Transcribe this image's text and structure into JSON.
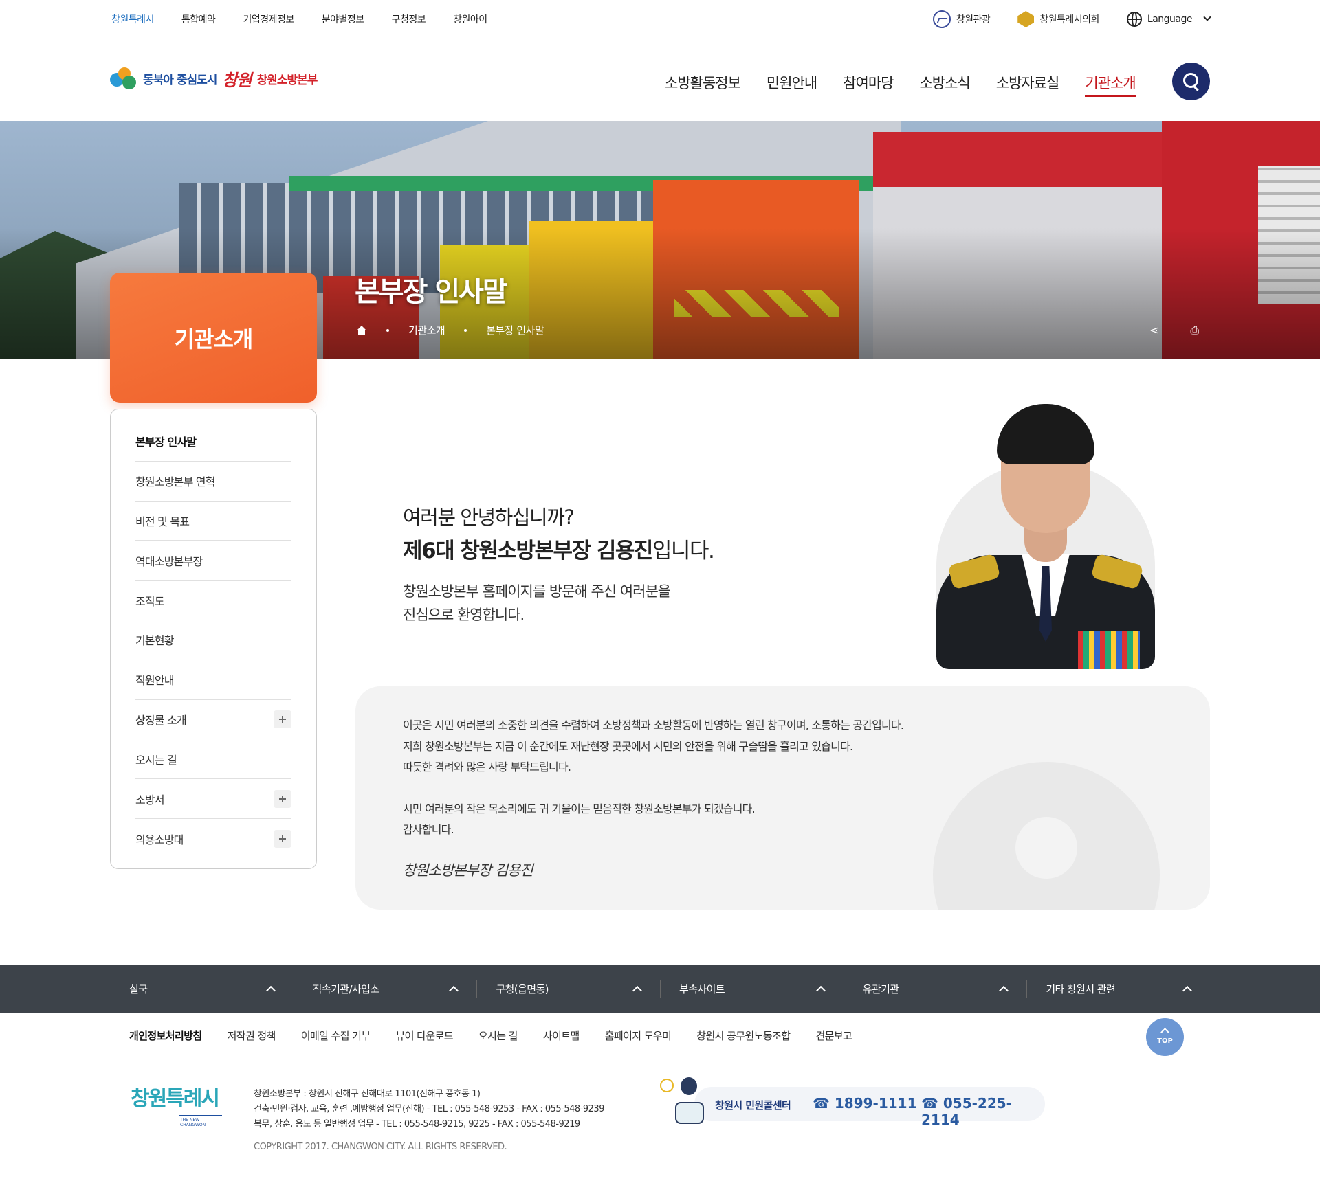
{
  "top_util": {
    "left_links": [
      "창원특례시",
      "통합예약",
      "기업경제정보",
      "분야별정보",
      "구청정보",
      "창원아이"
    ],
    "right_links": [
      "창원관광",
      "창원특례시의회",
      "Language"
    ]
  },
  "header": {
    "logo_text1": "동북아 중심도시",
    "logo_script": "창원",
    "logo_text2": "창원소방본부",
    "gnb": [
      "소방활동정보",
      "민원안내",
      "참여마당",
      "소방소식",
      "소방자료실",
      "기관소개"
    ]
  },
  "hero": {
    "title": "본부장 인사말",
    "breadcrumb": [
      "기관소개",
      "본부장 인사말"
    ],
    "share_icon": "share-icon",
    "print_icon": "print-icon"
  },
  "lnb": {
    "title": "기관소개",
    "items": [
      {
        "label": "본부장 인사말",
        "expandable": false
      },
      {
        "label": "창원소방본부 연혁",
        "expandable": false
      },
      {
        "label": "비전 및 목표",
        "expandable": false
      },
      {
        "label": "역대소방본부장",
        "expandable": false
      },
      {
        "label": "조직도",
        "expandable": false
      },
      {
        "label": "기본현황",
        "expandable": false
      },
      {
        "label": "직원안내",
        "expandable": false
      },
      {
        "label": "상징물 소개",
        "expandable": true
      },
      {
        "label": "오시는 길",
        "expandable": false
      },
      {
        "label": "소방서",
        "expandable": true
      },
      {
        "label": "의용소방대",
        "expandable": true
      }
    ]
  },
  "greeting": {
    "line1": "여러분 안녕하십니까?",
    "line2_bold": "제6대 창원소방본부장 김용진",
    "line2_rest": "입니다.",
    "line3": "창원소방본부 홈페이지를 방문해 주신 여러분을",
    "line4": "진심으로 환영합니다."
  },
  "message": {
    "paragraphs": [
      "이곳은 시민 여러분의 소중한 의견을 수렴하여 소방정책과 소방활동에 반영하는 열린 창구이며, 소통하는 공간입니다.",
      "저희 창원소방본부는 지금 이 순간에도 재난현장 곳곳에서 시민의 안전을 위해 구슬땀을 흘리고 있습니다.",
      "따듯한 격려와 많은 사랑 부탁드립니다.",
      "",
      "시민 여러분의 작은 목소리에도 귀 기울이는 믿음직한 창원소방본부가 되겠습니다.",
      "감사합니다."
    ],
    "signature": "창원소방본부장 김용진"
  },
  "footer": {
    "nav": [
      "실국",
      "직속기관/사업소",
      "구청(읍면동)",
      "부속사이트",
      "유관기관",
      "기타 창원시 관련"
    ],
    "links": [
      "개인정보처리방침",
      "저작권 정책",
      "이메일 수집 거부",
      "뷰어 다운로드",
      "오시는 길",
      "사이트맵",
      "홈페이지 도우미",
      "창원시 공무원노동조합",
      "견문보고"
    ],
    "top_label": "TOP",
    "logo_text": "창원특례시",
    "logo_sub": "THE NEW CHANGWON",
    "address": "창원소방본부 : 창원시 진해구 진해대로 1101(진해구 풍호동 1)",
    "dept1": "건축·민원·검사, 교육, 훈련 ,예방행정 업무(진해) - TEL : 055-548-9253 - FAX : 055-548-9239",
    "dept2": "복무, 상훈, 용도 등 일반행정 업무 - TEL : 055-548-9215, 9225 - FAX : 055-548-9219",
    "copyright": "COPYRIGHT 2017. CHANGWON CITY. ALL RIGHTS RESERVED.",
    "call_label": "창원시 민원콜센터",
    "phone1": "☎ 1899-1111",
    "phone2": "☎ 055-225-2114"
  }
}
